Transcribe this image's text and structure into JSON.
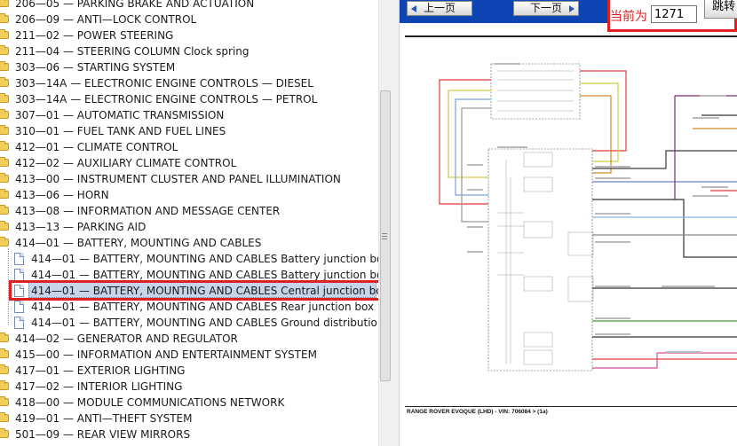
{
  "tree": {
    "items": [
      {
        "code": "206—05",
        "title": "PARKING BRAKE AND ACTUATION",
        "type": "folder"
      },
      {
        "code": "206—09",
        "title": "ANTI—LOCK CONTROL",
        "type": "folder"
      },
      {
        "code": "211—02",
        "title": "POWER STEERING",
        "type": "folder"
      },
      {
        "code": "211—04",
        "title": "STEERING COLUMN Clock spring",
        "type": "folder"
      },
      {
        "code": "303—06",
        "title": "STARTING SYSTEM",
        "type": "folder"
      },
      {
        "code": "303—14A",
        "title": "ELECTRONIC ENGINE CONTROLS — DIESEL",
        "type": "folder"
      },
      {
        "code": "303—14A",
        "title": "ELECTRONIC ENGINE CONTROLS — PETROL",
        "type": "folder"
      },
      {
        "code": "307—01",
        "title": "AUTOMATIC TRANSMISSION",
        "type": "folder"
      },
      {
        "code": "310—01",
        "title": "FUEL TANK AND FUEL LINES",
        "type": "folder"
      },
      {
        "code": "412—01",
        "title": "CLIMATE CONTROL",
        "type": "folder"
      },
      {
        "code": "412—02",
        "title": "AUXILIARY CLIMATE CONTROL",
        "type": "folder"
      },
      {
        "code": "413—00",
        "title": "INSTRUMENT CLUSTER AND PANEL ILLUMINATION",
        "type": "folder"
      },
      {
        "code": "413—06",
        "title": "HORN",
        "type": "folder"
      },
      {
        "code": "413—08",
        "title": "INFORMATION AND MESSAGE CENTER",
        "type": "folder"
      },
      {
        "code": "413—13",
        "title": "PARKING AID",
        "type": "folder"
      },
      {
        "code": "414—01",
        "title": "BATTERY, MOUNTING AND CABLES",
        "type": "folder-open"
      },
      {
        "code": "414—01",
        "title": "BATTERY, MOUNTING AND CABLES Battery junction box",
        "type": "doc"
      },
      {
        "code": "414—01",
        "title": "BATTERY, MOUNTING AND CABLES Battery junction box",
        "type": "doc"
      },
      {
        "code": "414—01",
        "title": "BATTERY, MOUNTING AND CABLES Central junction box",
        "type": "doc",
        "selected": true
      },
      {
        "code": "414—01",
        "title": "BATTERY, MOUNTING AND CABLES Rear junction box",
        "type": "doc"
      },
      {
        "code": "414—01",
        "title": "BATTERY, MOUNTING AND CABLES Ground distribution",
        "type": "doc"
      },
      {
        "code": "414—02",
        "title": "GENERATOR AND REGULATOR",
        "type": "folder"
      },
      {
        "code": "415—00",
        "title": "INFORMATION AND ENTERTAINMENT SYSTEM",
        "type": "folder"
      },
      {
        "code": "417—01",
        "title": "EXTERIOR LIGHTING",
        "type": "folder"
      },
      {
        "code": "417—02",
        "title": "INTERIOR LIGHTING",
        "type": "folder"
      },
      {
        "code": "418—00",
        "title": "MODULE COMMUNICATIONS NETWORK",
        "type": "folder"
      },
      {
        "code": "419—01",
        "title": "ANTI—THEFT SYSTEM",
        "type": "folder"
      },
      {
        "code": "501—09",
        "title": "REAR VIEW MIRRORS",
        "type": "folder"
      }
    ]
  },
  "viewer": {
    "prev_label": "上一页",
    "next_label": "下一页",
    "current_page_label": "当前为",
    "current_page_value": "1271",
    "go_label": "跳转",
    "footer": "RANGE ROVER EVOQUE (LHD) - VIN: 706084 > (1a)"
  },
  "colors": {
    "nav_bar": "#0f44b5",
    "highlight": "#e0201e",
    "selection": "#c7d5ea"
  }
}
